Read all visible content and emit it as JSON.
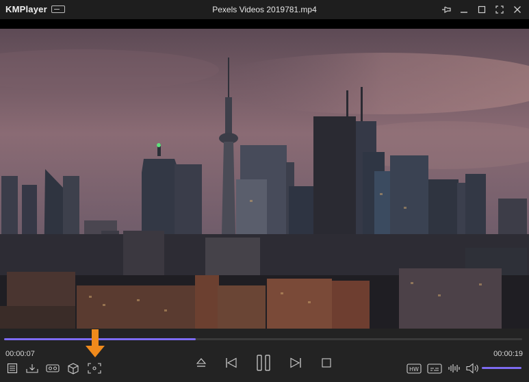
{
  "app": {
    "logo_text": "KMPlayer",
    "title": "Pexels Videos 2019781.mp4"
  },
  "window_controls": [
    "pin-icon",
    "minimize-icon",
    "maximize-icon",
    "fullscreen-icon",
    "close-icon"
  ],
  "playback": {
    "elapsed": "00:00:07",
    "total": "00:00:19",
    "progress": 0.37,
    "volume": 1.0
  },
  "left_toolbar": [
    "playlist-icon",
    "download-icon",
    "vr-icon",
    "3d-box-icon",
    "screen-capture-icon"
  ],
  "center_controls": [
    "eject-icon",
    "previous-icon",
    "pause-icon",
    "next-icon",
    "stop-icon"
  ],
  "right_toolbar": [
    "hw-decoder-icon",
    "subtitle-icon",
    "audio-wave-icon",
    "speaker-icon"
  ],
  "hw_label": "HW",
  "colors": {
    "accent": "#7d6bf2",
    "annotation_arrow": "#f08a1c",
    "titlebar": "#1e1e1e",
    "controls_bg": "#232323"
  }
}
